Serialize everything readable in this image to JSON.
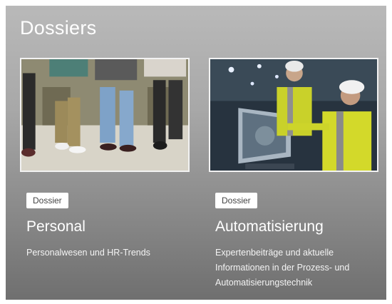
{
  "section": {
    "title": "Dossiers"
  },
  "cards": [
    {
      "badge": "Dossier",
      "title": "Personal",
      "description": "Personalwesen und HR-Trends",
      "image": "people-sitting-waiting-photo"
    },
    {
      "badge": "Dossier",
      "title": "Automatisierung",
      "description": "Expertenbeiträge und aktuelle Informationen in der Prozess- und Automatisierungstechnik",
      "image": "engineers-factory-monitor-photo"
    }
  ]
}
